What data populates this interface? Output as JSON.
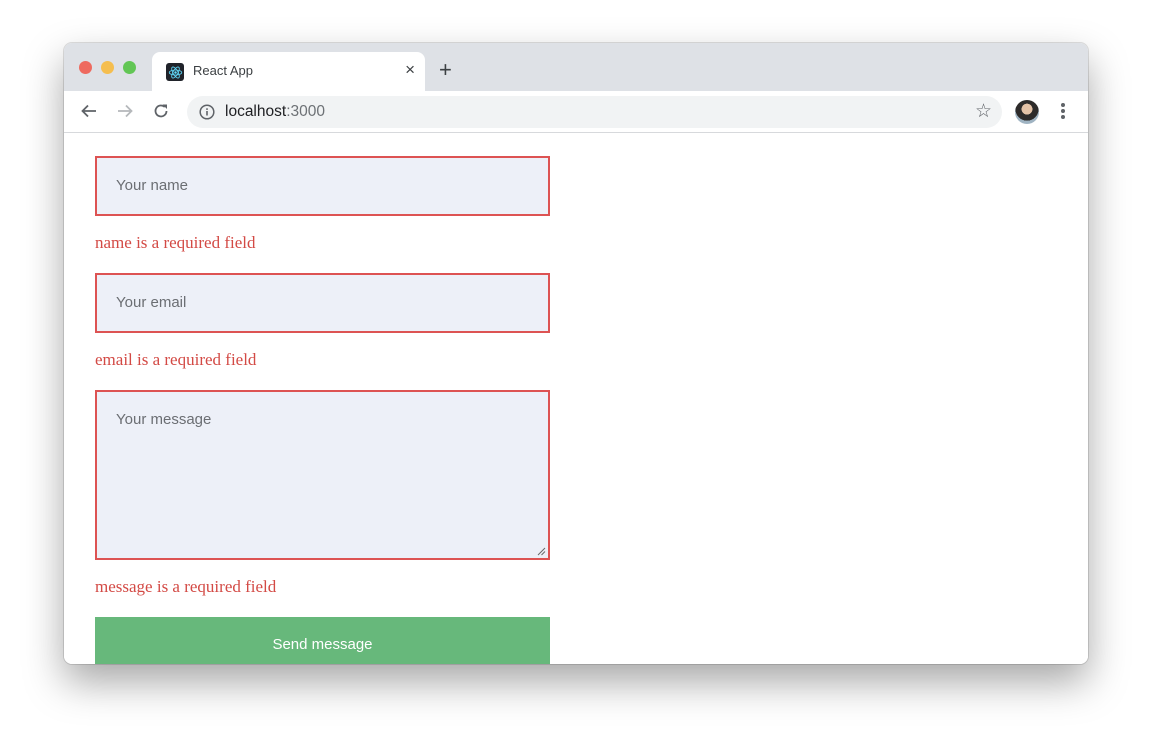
{
  "browser": {
    "tab": {
      "title": "React App",
      "favicon": "react-logo-icon",
      "close_label": "×"
    },
    "new_tab_label": "+",
    "nav": {
      "back": "arrow-left-icon",
      "forward": "arrow-right-icon",
      "reload": "reload-icon"
    },
    "url": {
      "host": "localhost",
      "port": ":3000"
    },
    "bookmark_icon": "☆",
    "profile": "avatar"
  },
  "form": {
    "name": {
      "placeholder": "Your name",
      "error": "name is a required field"
    },
    "email": {
      "placeholder": "Your email",
      "error": "email is a required field"
    },
    "message": {
      "placeholder": "Your message",
      "error": "message is a required field"
    },
    "submit_label": "Send message"
  },
  "colors": {
    "error": "#dd5353",
    "field_bg": "#edf0f8",
    "submit_bg": "#67b87b",
    "tabstrip_bg": "#dee1e6"
  }
}
